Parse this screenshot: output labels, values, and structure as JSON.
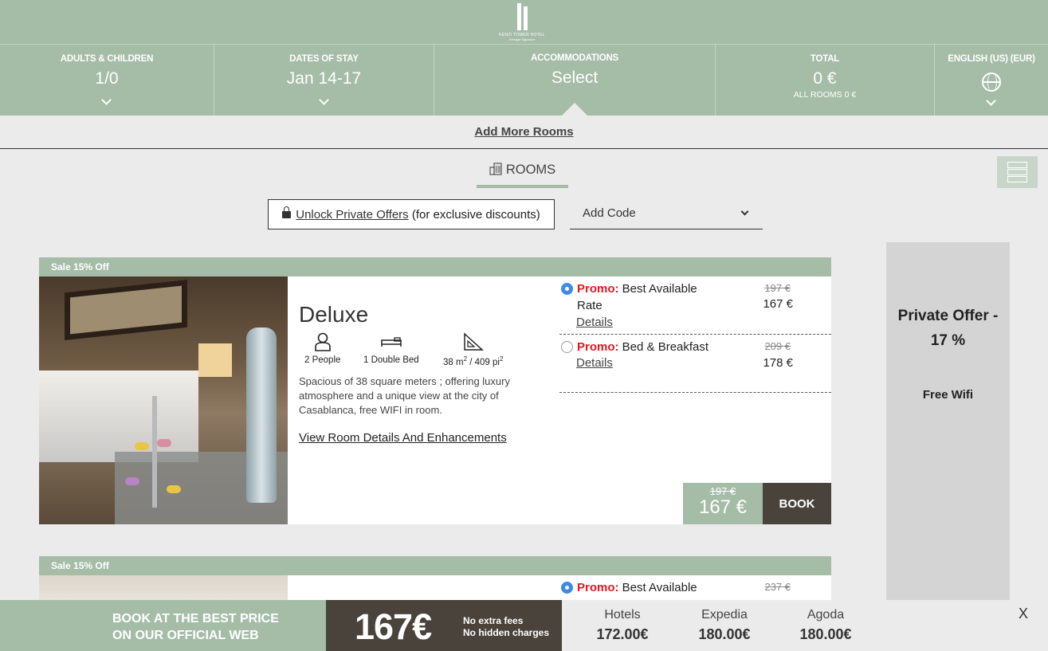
{
  "logo": {
    "name": "KENZI TOWER HOTEL",
    "tagline": "Prestige Signature"
  },
  "nav": {
    "adults": {
      "label": "ADULTS & CHILDREN",
      "value": "1/0"
    },
    "dates": {
      "label": "DATES OF STAY",
      "value": "Jan 14-17"
    },
    "accommodations": {
      "label": "ACCOMMODATIONS",
      "value": "Select"
    },
    "total": {
      "label": "TOTAL",
      "value": "0 €",
      "sub": "ALL ROOMS 0 €"
    },
    "language": {
      "label": "ENGLISH (US) (EUR)"
    }
  },
  "add_rooms": "Add More Rooms",
  "rooms_tab": "ROOMS",
  "unlock": {
    "link": "Unlock Private Offers",
    "suffix": "(for exclusive discounts)"
  },
  "code": {
    "label": "Add Code"
  },
  "side_offer": {
    "title": "Private Offer - 17 %",
    "feature": "Free Wifi"
  },
  "rooms": [
    {
      "badge": "Sale 15% Off",
      "name": "Deluxe",
      "features": {
        "people": "2 People",
        "bed": "1 Double Bed",
        "size_prefix": "38 m",
        "size_mid": " / 409 pi",
        "sup": "2"
      },
      "description": "Spacious of 38 square meters ; offering luxury atmosphere and a unique view at the city of Casablanca, free WIFI in room.",
      "details_link": "View Room Details And Enhancements",
      "rates": [
        {
          "promo": "Promo:",
          "name": "Best Available Rate",
          "details": "Details",
          "old": "197 €",
          "new": "167 €",
          "selected": true
        },
        {
          "promo": "Promo:",
          "name": "Bed & Breakfast",
          "details": "Details",
          "old": "209 €",
          "new": "178 €",
          "selected": false
        }
      ],
      "price_old": "197 €",
      "price_new": "167 €",
      "book": "BOOK"
    },
    {
      "badge": "Sale 15% Off",
      "rates": [
        {
          "promo": "Promo:",
          "name": "Best Available",
          "old": "237 €",
          "selected": true
        }
      ]
    }
  ],
  "bottom": {
    "line1": "BOOK AT THE BEST PRICE",
    "line2": "ON OUR OFFICIAL WEB",
    "price": "167€",
    "note1": "No extra fees",
    "note2": "No hidden charges",
    "compare": [
      {
        "name": "Hotels",
        "price": "172.00€"
      },
      {
        "name": "Expedia",
        "price": "180.00€"
      },
      {
        "name": "Agoda",
        "price": "180.00€"
      }
    ],
    "close": "X"
  },
  "colors": {
    "sage": "#a5bca7",
    "dark": "#4a433b",
    "promo_red": "#e0191f",
    "radio_blue": "#3e8ae8"
  }
}
